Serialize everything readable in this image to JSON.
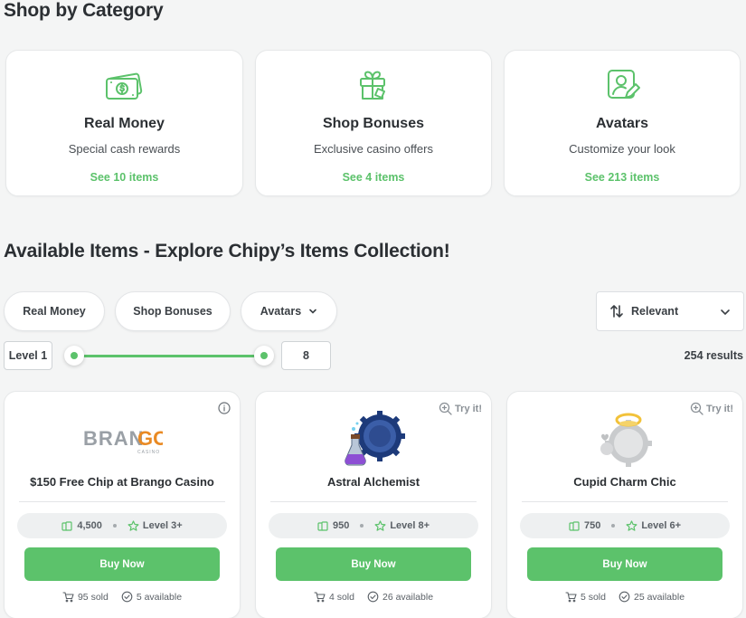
{
  "page": {
    "section1_title": "Shop by Category",
    "section2_title": "Available Items - Explore Chipy’s Items Collection!"
  },
  "categories": [
    {
      "title": "Real Money",
      "subtitle": "Special cash rewards",
      "link": "See 10 items",
      "icon": "money-bills-icon"
    },
    {
      "title": "Shop Bonuses",
      "subtitle": "Exclusive casino offers",
      "link": "See 4 items",
      "icon": "gift-icon"
    },
    {
      "title": "Avatars",
      "subtitle": "Customize your look",
      "link": "See 213 items",
      "icon": "avatar-edit-icon"
    }
  ],
  "filters": {
    "chips": [
      "Real Money",
      "Shop Bonuses",
      "Avatars"
    ],
    "sort_label": "Relevant",
    "level_min_label": "Level 1",
    "level_max_value": "8",
    "results": "254 results"
  },
  "items": [
    {
      "name": "$150 Free Chip at Brango Casino",
      "price": "4,500",
      "level": "Level 3+",
      "buy": "Buy Now",
      "sold": "95 sold",
      "available": "5 available",
      "top_action": "",
      "logo_text": "BRANGO",
      "logo_sub": "CASINO"
    },
    {
      "name": "Astral Alchemist",
      "price": "950",
      "level": "Level 8+",
      "buy": "Buy Now",
      "sold": "4 sold",
      "available": "26 available",
      "top_action": "Try it!"
    },
    {
      "name": "Cupid Charm Chic",
      "price": "750",
      "level": "Level 6+",
      "buy": "Buy Now",
      "sold": "5 sold",
      "available": "25 available",
      "top_action": "Try it!"
    }
  ],
  "colors": {
    "accent": "#5cc26b",
    "text": "#2b2f33",
    "background": "#f4f5f5"
  }
}
